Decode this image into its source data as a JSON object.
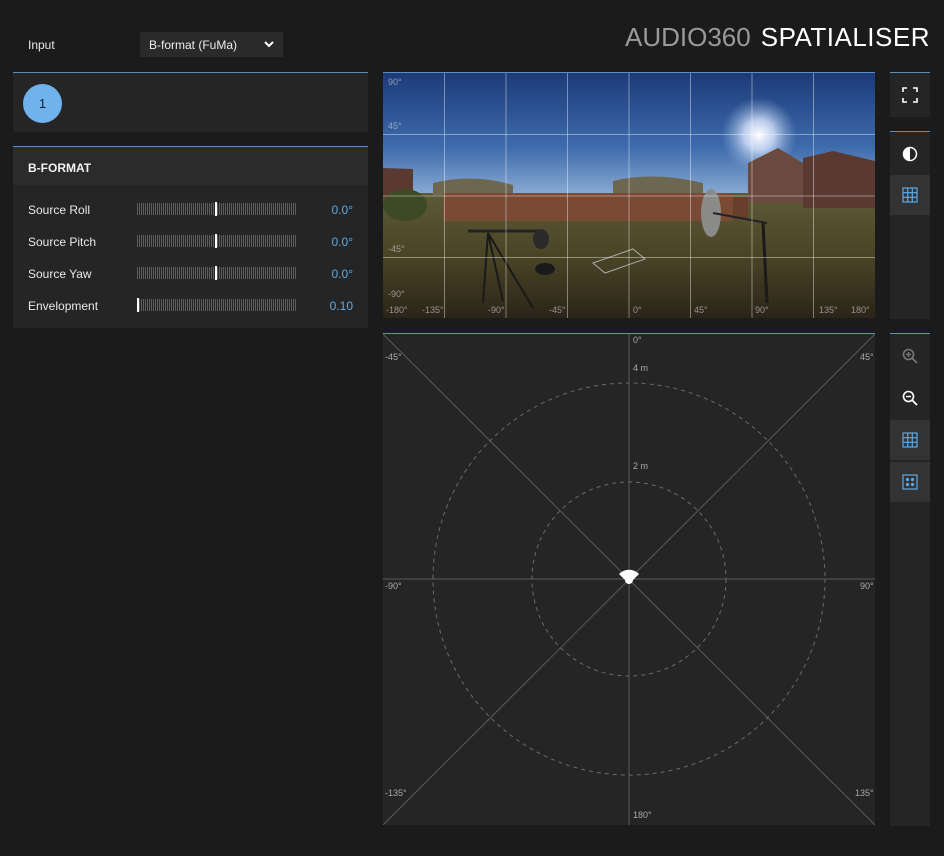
{
  "header": {
    "input_label": "Input",
    "input_select_value": "B-format (FuMa)",
    "brand_thin": "AUDIO360",
    "brand_bold": "SPATIALISER"
  },
  "source": {
    "number": "1"
  },
  "bformat": {
    "title": "B-FORMAT",
    "params": [
      {
        "label": "Source Roll",
        "value": "0.0°",
        "level": 0.5
      },
      {
        "label": "Source Pitch",
        "value": "0.0°",
        "level": 0.5
      },
      {
        "label": "Source Yaw",
        "value": "0.0°",
        "level": 0.5
      },
      {
        "label": "Envelopment",
        "value": "0.10",
        "level": 0.0
      }
    ]
  },
  "video": {
    "elev_labels": [
      "90°",
      "45°",
      "-45°",
      "-90°"
    ],
    "azim_labels": [
      "-180°",
      "-135°",
      "-90°",
      "-45°",
      "0°",
      "45°",
      "90°",
      "135°",
      "180°"
    ]
  },
  "topdown": {
    "labels": {
      "front": "0°",
      "back": "180°",
      "left": "-90°",
      "right": "90°",
      "front_left": "-45°",
      "front_right": "45°",
      "back_left": "-135°",
      "back_right": "135°"
    },
    "rings": [
      "4 m",
      "2 m"
    ]
  },
  "toolbar": {
    "icons": [
      "fullscreen-icon",
      "contrast-icon",
      "grid-icon",
      "zoom-in-icon",
      "zoom-out-icon",
      "grid-icon",
      "dots-icon"
    ]
  },
  "colors": {
    "accent": "#5aaae8",
    "source_circle": "#6fb2ec",
    "panel_border": "#5a8fbf",
    "background": "#1b1b1b"
  }
}
